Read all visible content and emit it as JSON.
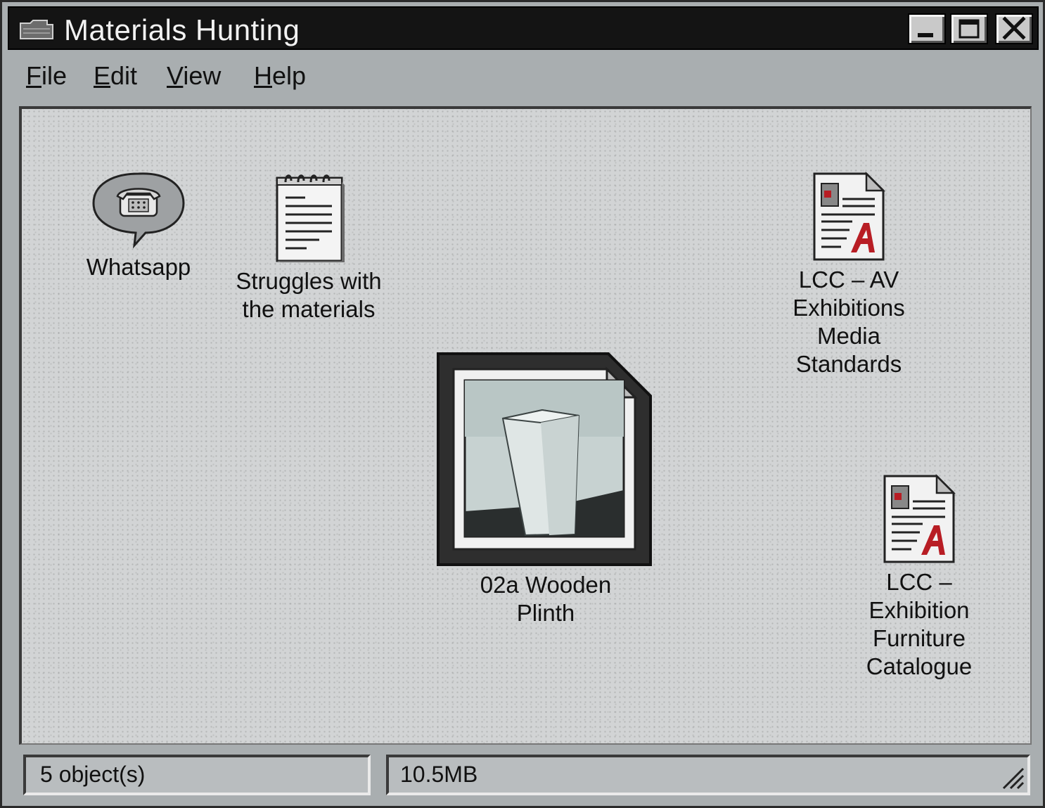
{
  "window": {
    "title": "Materials Hunting",
    "title_icon": "folder-icon"
  },
  "controls": {
    "minimize_icon": "minimize-icon",
    "maximize_icon": "maximize-icon",
    "close_icon": "close-icon"
  },
  "menu": {
    "items": [
      {
        "label": "File",
        "accel": "F",
        "rest": "ile"
      },
      {
        "label": "Edit",
        "accel": "E",
        "rest": "dit"
      },
      {
        "label": "View",
        "accel": "V",
        "rest": "iew"
      },
      {
        "label": "Help",
        "accel": "H",
        "rest": "elp"
      }
    ]
  },
  "files": [
    {
      "name": "Whatsapp",
      "icon": "whatsapp-phone-bubble-icon",
      "lines": [
        "Whatsapp"
      ]
    },
    {
      "name": "Struggles with the materials",
      "icon": "notepad-icon",
      "lines": [
        "Struggles with",
        "the materials"
      ]
    },
    {
      "name": "LCC – AV Exhibitions Media Standards",
      "icon": "pdf-document-icon",
      "lines": [
        "LCC – AV",
        "Exhibitions",
        "Media",
        "Standards"
      ]
    },
    {
      "name": "02a Wooden Plinth",
      "icon": "image-thumbnail-icon",
      "lines": [
        "02a Wooden",
        "Plinth"
      ]
    },
    {
      "name": "LCC – Exhibition Furniture Catalogue",
      "icon": "pdf-document-icon",
      "lines": [
        "LCC –",
        "Exhibition",
        "Furniture",
        "Catalogue"
      ]
    }
  ],
  "status": {
    "objects": "5 object(s)",
    "size": "10.5MB"
  },
  "colors": {
    "titlebar": "#141414",
    "window": "#a9aeb0",
    "content": "#d2d4d5",
    "pdf_accent": "#b81d24"
  }
}
